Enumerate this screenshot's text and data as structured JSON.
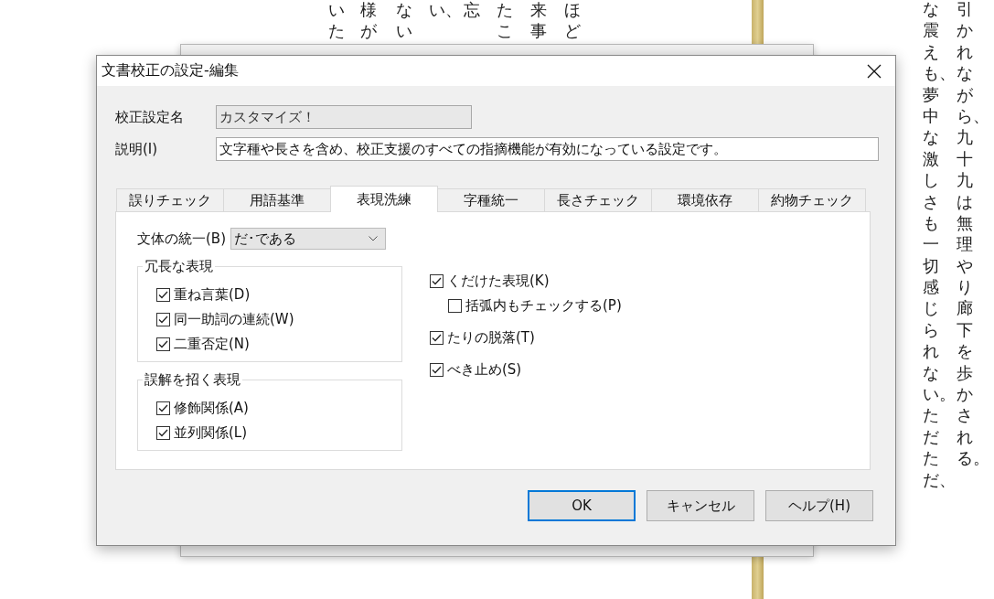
{
  "document": {
    "left_columns": [
      "いた",
      "様が",
      "ない",
      "い、",
      "忘",
      "たこ",
      "来事",
      "ほど"
    ],
    "right_columns": [
      "な震えも、夢中な激しさも一切感じられない。ただただ、",
      "引かれながら、九十九は無理やり廊下を歩かされる。"
    ]
  },
  "dialog": {
    "title": "文書校正の設定-編集",
    "fields": [
      {
        "label": "校正設定名",
        "value": "カスタマイズ！",
        "disabled": true
      },
      {
        "label": "説明(I)",
        "value": "文字種や長さを含め、校正支援のすべての指摘機能が有効になっている設定です。",
        "disabled": false
      }
    ],
    "tabs": [
      {
        "label": "誤りチェック",
        "selected": false
      },
      {
        "label": "用語基準",
        "selected": false
      },
      {
        "label": "表現洗練",
        "selected": true
      },
      {
        "label": "字種統一",
        "selected": false
      },
      {
        "label": "長さチェック",
        "selected": false
      },
      {
        "label": "環境依存",
        "selected": false
      },
      {
        "label": "約物チェック",
        "selected": false
      }
    ],
    "style_select": {
      "label": "文体の統一(B)",
      "value": "だ･である"
    },
    "groups": [
      {
        "title": "冗長な表現",
        "items": [
          {
            "label": "重ね言葉(D)",
            "checked": true
          },
          {
            "label": "同一助詞の連続(W)",
            "checked": true
          },
          {
            "label": "二重否定(N)",
            "checked": true
          }
        ]
      },
      {
        "title": "誤解を招く表現",
        "items": [
          {
            "label": "修飾関係(A)",
            "checked": true
          },
          {
            "label": "並列関係(L)",
            "checked": true
          }
        ]
      }
    ],
    "options": [
      {
        "label": "くだけた表現(K)",
        "checked": true,
        "children": [
          {
            "label": "括弧内もチェックする(P)",
            "checked": false
          }
        ]
      },
      {
        "label": "たりの脱落(T)",
        "checked": true
      },
      {
        "label": "べき止め(S)",
        "checked": true
      }
    ],
    "buttons": [
      {
        "label": "OK",
        "default": true
      },
      {
        "label": "キャンセル",
        "default": false
      },
      {
        "label": "ヘルプ(H)",
        "default": false
      }
    ]
  }
}
